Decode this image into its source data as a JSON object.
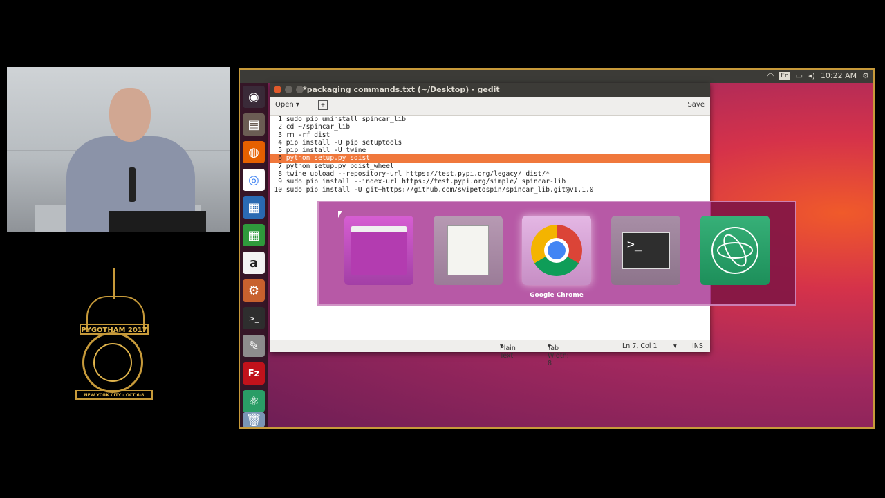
{
  "logo": {
    "banner": "PYGOTHAM 2017",
    "base": "NEW YORK CITY - OCT 6-8"
  },
  "topbar": {
    "lang": "En",
    "clock": "10:22 AM"
  },
  "launcher": {
    "items": [
      {
        "name": "ubuntu-dash-icon",
        "glyph": "◉"
      },
      {
        "name": "files-icon",
        "glyph": "▤"
      },
      {
        "name": "firefox-icon",
        "glyph": "◍"
      },
      {
        "name": "chrome-icon",
        "glyph": "◎"
      },
      {
        "name": "libreoffice-writer-icon",
        "glyph": "▦"
      },
      {
        "name": "libreoffice-calc-icon",
        "glyph": "▦"
      },
      {
        "name": "amazon-icon",
        "glyph": "a"
      },
      {
        "name": "settings-icon",
        "glyph": "⚙"
      },
      {
        "name": "terminal-icon",
        "glyph": ">_"
      },
      {
        "name": "text-editor-icon",
        "glyph": "✎"
      },
      {
        "name": "filezilla-icon",
        "glyph": "Fz"
      },
      {
        "name": "atom-icon",
        "glyph": "⚛"
      }
    ]
  },
  "gedit": {
    "title": "*packaging commands.txt (~/Desktop) - gedit",
    "open_label": "Open",
    "save_label": "Save",
    "lines": [
      {
        "num": "1",
        "code": "sudo pip uninstall spincar_lib"
      },
      {
        "num": "2",
        "code": "cd ~/spincar_lib"
      },
      {
        "num": "3",
        "code": "rm -rf dist"
      },
      {
        "num": "4",
        "code": "pip install -U pip setuptools"
      },
      {
        "num": "5",
        "code": "pip install -U twine"
      },
      {
        "num": "6",
        "code": "python setup.py sdist"
      },
      {
        "num": "7",
        "code": "python setup.py bdist_wheel"
      },
      {
        "num": "8",
        "code": "twine upload --repository-url https://test.pypi.org/legacy/ dist/*"
      },
      {
        "num": "9",
        "code": "sudo pip install --index-url https://test.pypi.org/simple/ spincar-lib"
      },
      {
        "num": "10",
        "code": "sudo pip install -U git+https://github.com/swipetospin/spincar_lib.git@v1.1.0"
      }
    ],
    "status": {
      "language": "Plain Text",
      "tab_width": "Tab Width: 8",
      "position": "Ln 7, Col 1",
      "mode": "INS"
    }
  },
  "switcher": {
    "selected_label": "Google Chrome"
  },
  "colors": {
    "highlight": "#f0783c",
    "frame": "#c79a3a"
  }
}
